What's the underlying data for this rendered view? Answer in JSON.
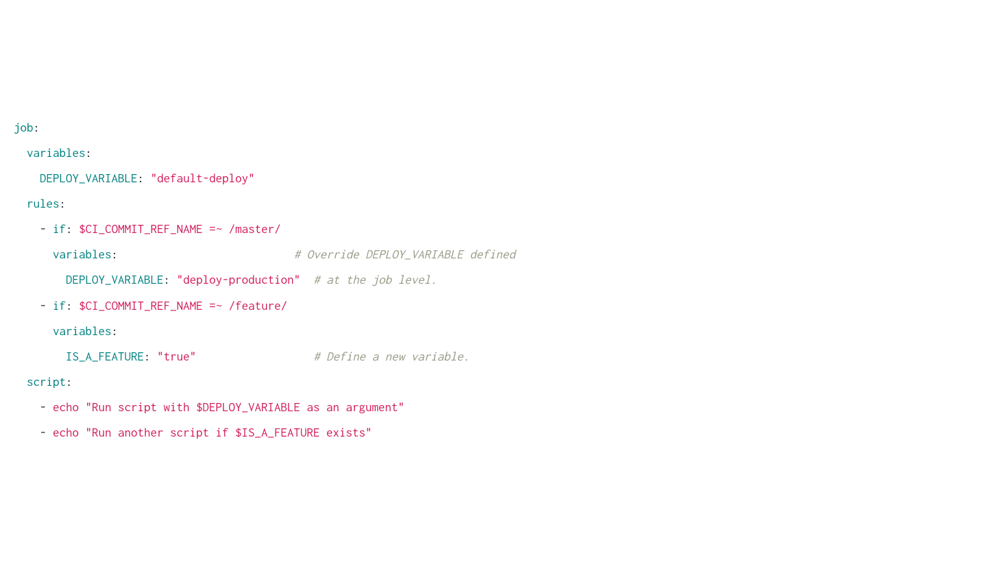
{
  "code": {
    "l1": {
      "k1": "job",
      "p1": ":"
    },
    "l2": {
      "k1": "variables",
      "p1": ":"
    },
    "l3": {
      "k1": "DEPLOY_VARIABLE",
      "p1": ":",
      "s1": "\"default-deploy\""
    },
    "l4": {
      "k1": "rules",
      "p1": ":"
    },
    "l5": {
      "p1": "-",
      "k1": "if",
      "p2": ":",
      "s1": "$CI_COMMIT_REF_NAME =~ /master/"
    },
    "l6": {
      "k1": "variables",
      "p1": ":",
      "c1": "# Override DEPLOY_VARIABLE defined"
    },
    "l7": {
      "k1": "DEPLOY_VARIABLE",
      "p1": ":",
      "s1": "\"deploy-production\"",
      "c1": "# at the job level."
    },
    "l8": {
      "p1": "-",
      "k1": "if",
      "p2": ":",
      "s1": "$CI_COMMIT_REF_NAME =~ /feature/"
    },
    "l9": {
      "k1": "variables",
      "p1": ":"
    },
    "l10": {
      "k1": "IS_A_FEATURE",
      "p1": ":",
      "s1": "\"true\"",
      "c1": "# Define a new variable."
    },
    "l11": {
      "k1": "script",
      "p1": ":"
    },
    "l12": {
      "p1": "-",
      "s1": "echo \"Run script with $DEPLOY_VARIABLE as an argument\""
    },
    "l13": {
      "p1": "-",
      "s1": "echo \"Run another script if $IS_A_FEATURE exists\""
    }
  }
}
